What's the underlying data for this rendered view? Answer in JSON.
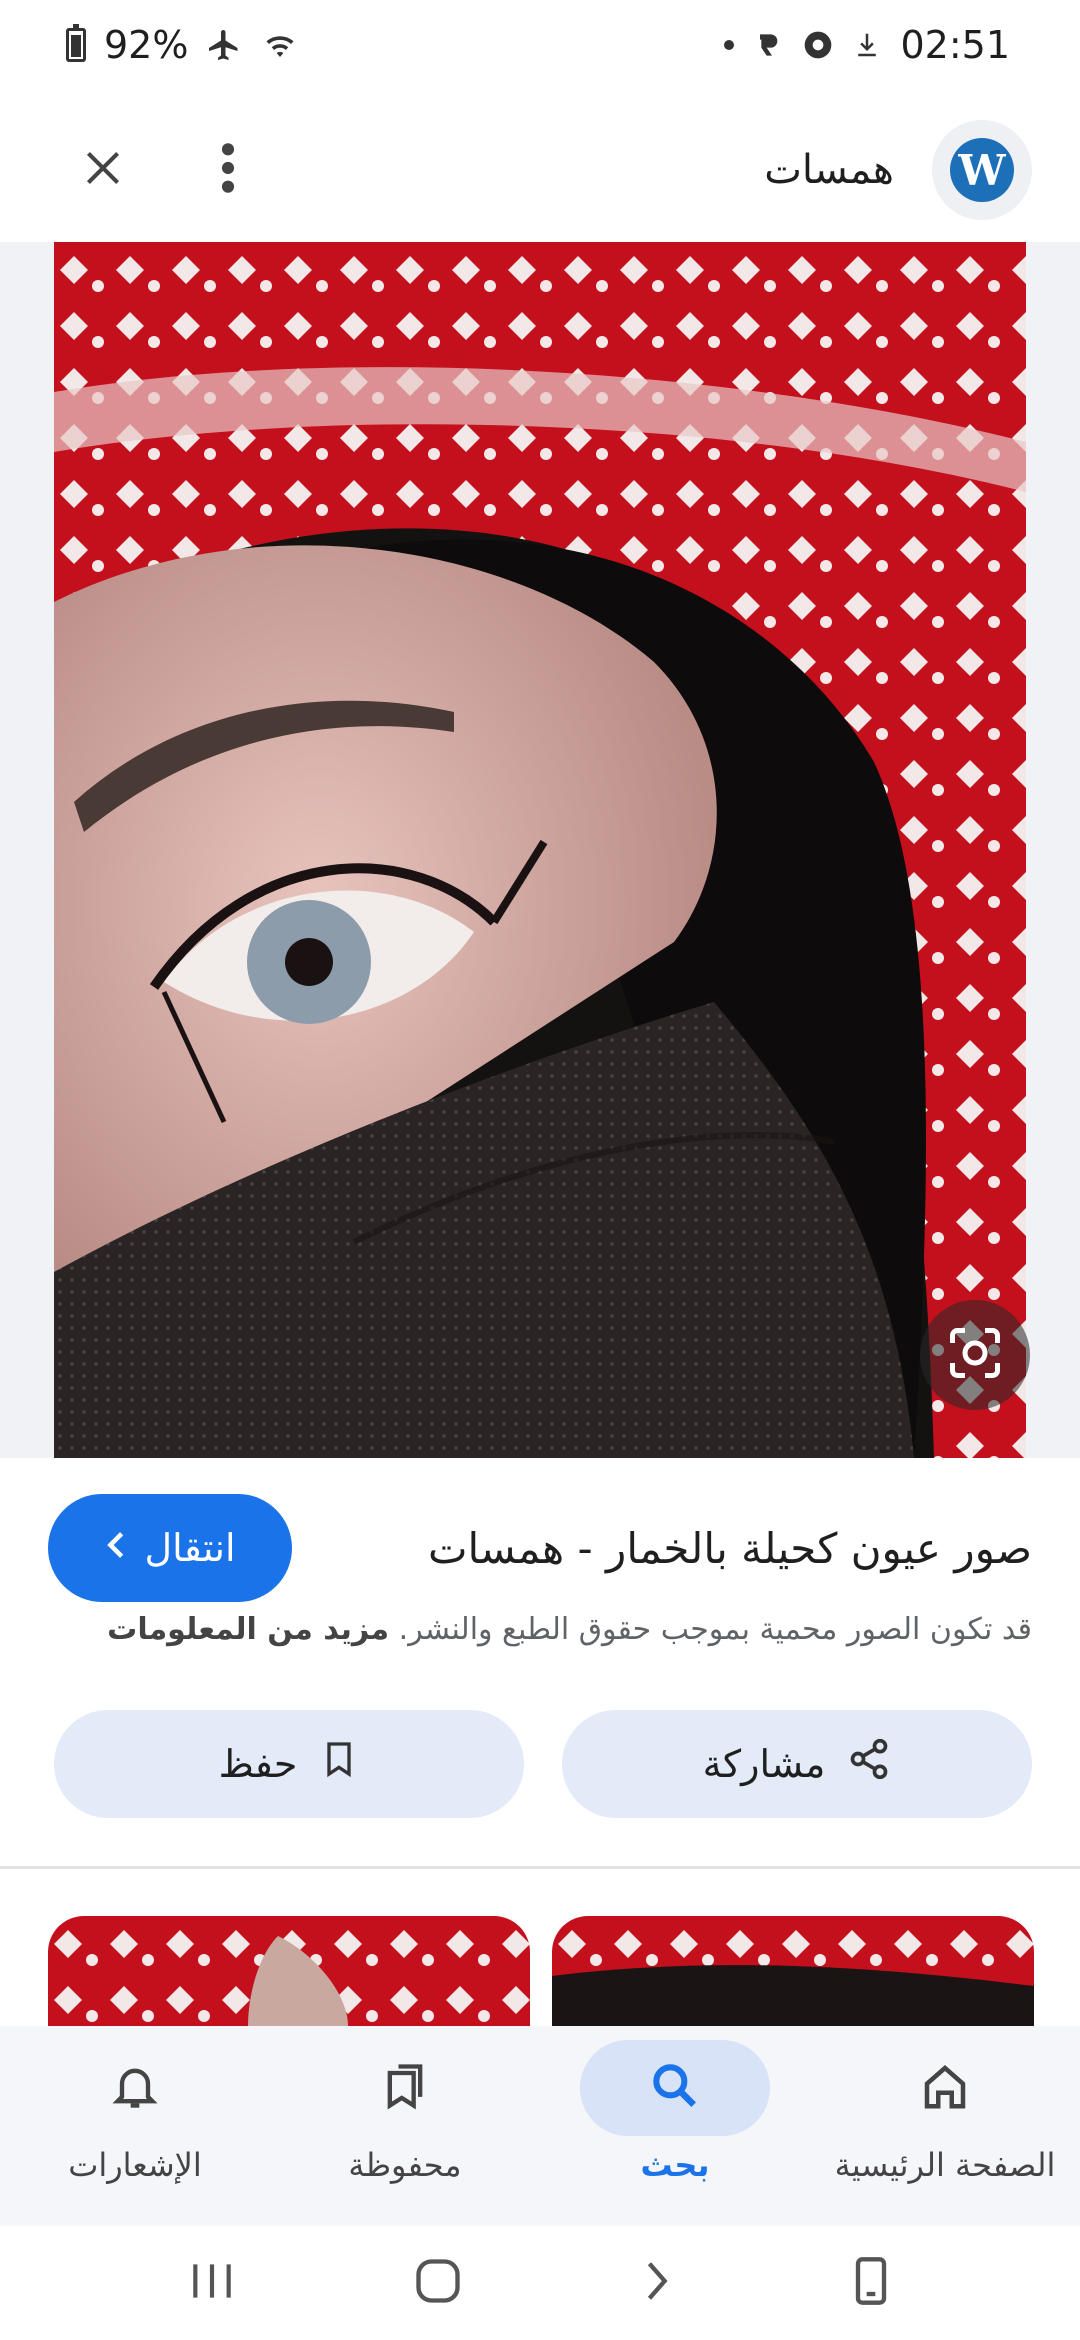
{
  "status_bar": {
    "battery": "92%",
    "time": "02:51"
  },
  "app_bar": {
    "site_name": "همسات"
  },
  "image": {
    "title": "صور عيون كحيلة بالخمار - همسات",
    "copyright_notice": "قد تكون الصور محمية بموجب حقوق الطبع والنشر.",
    "more_info_link": "مزيد من المعلومات",
    "visit_label": "انتقال"
  },
  "actions": {
    "save_label": "حفظ",
    "share_label": "مشاركة"
  },
  "bottom_nav": {
    "items": [
      {
        "label": "الإشعارات",
        "icon": "bell-icon",
        "active": false
      },
      {
        "label": "محفوظة",
        "icon": "bookmarks-icon",
        "active": false
      },
      {
        "label": "بحث",
        "icon": "search-icon",
        "active": true
      },
      {
        "label": "الصفحة الرئيسية",
        "icon": "home-icon",
        "active": false
      }
    ]
  },
  "colors": {
    "accent": "#1a73e8",
    "action_bg": "#e3eaf8",
    "nav_active_bg": "#d8e3f8"
  }
}
